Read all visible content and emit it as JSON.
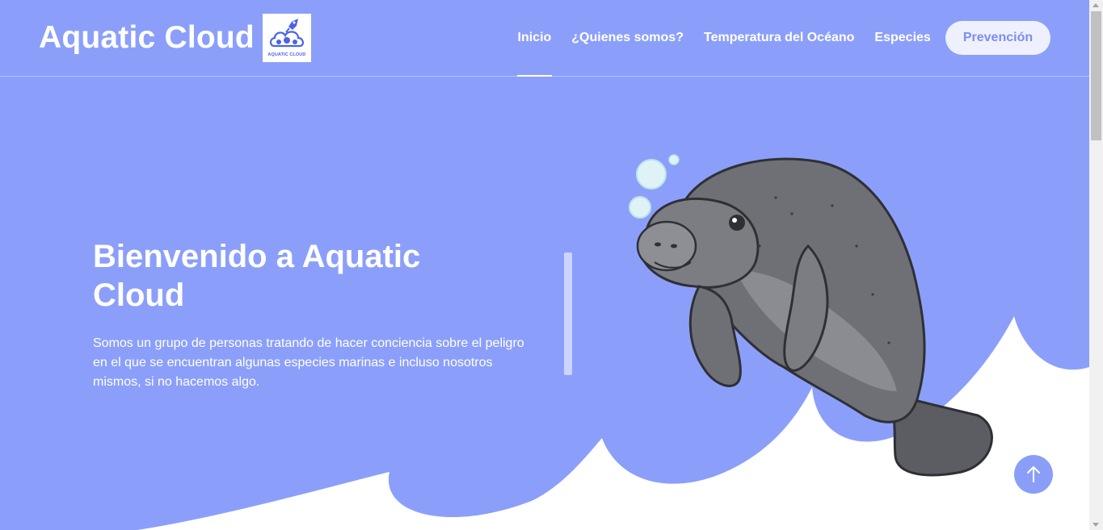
{
  "brand": {
    "title": "Aquatic Cloud",
    "logo_caption": "AQUATIC CLOUD"
  },
  "nav": {
    "items": [
      {
        "label": "Inicio"
      },
      {
        "label": "¿Quienes somos?"
      },
      {
        "label": "Temperatura del Océano"
      },
      {
        "label": "Especies"
      }
    ],
    "cta_label": "Prevención"
  },
  "hero": {
    "title": "Bienvenido a Aquatic Cloud",
    "description": "Somos un grupo de personas tratando de hacer conciencia sobre el peligro en el que se encuentran algunas especies marinas e incluso nosotros mismos, si no hacemos algo."
  },
  "icons": {
    "logo": "cloud-rocket-logo-icon",
    "illustration": "manatee-illustration",
    "back_to_top": "arrow-up-icon"
  },
  "colors": {
    "background": "#8b9ffa",
    "waves": "#ffffff",
    "cta_background": "#eef1fd",
    "cta_text": "#7b8ef2",
    "manatee": "#6e7076"
  }
}
